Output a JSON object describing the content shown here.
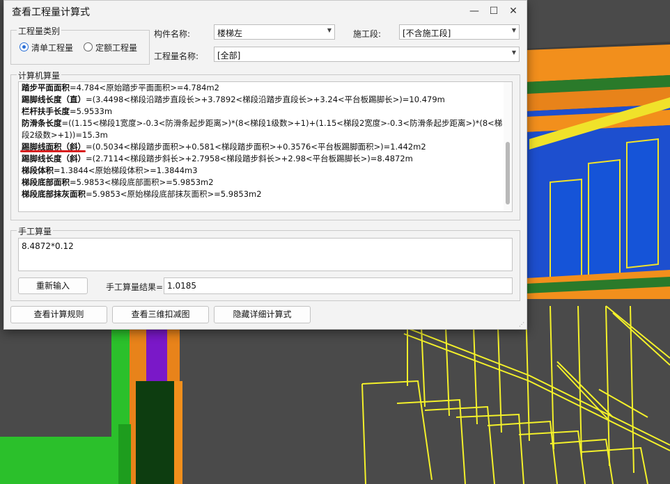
{
  "window": {
    "title": "查看工程量计算式",
    "minimize": "—",
    "maximize": "☐",
    "close": "✕"
  },
  "category": {
    "group_label": "工程量类别",
    "options": [
      {
        "label": "清单工程量",
        "selected": true
      },
      {
        "label": "定额工程量",
        "selected": false
      }
    ]
  },
  "filters": {
    "component_label": "构件名称:",
    "component_value": "楼梯左",
    "stage_label": "施工段:",
    "stage_value": "[不含施工段]",
    "quantity_label": "工程量名称:",
    "quantity_value": "[全部]"
  },
  "computed": {
    "group_label": "计算机算量",
    "lines": [
      {
        "name": "踏步平面面积",
        "formula": "=4.784<原始踏步平面面积>=4.784m2"
      },
      {
        "name": "踢脚线长度（直）",
        "formula": "=(3.4498<梯段沿踏步直段长>+3.7892<梯段沿踏步直段长>+3.24<平台板踢脚长>)=10.479m"
      },
      {
        "name": "栏杆扶手长度",
        "formula": "=5.9533m"
      },
      {
        "name": "防滑条长度",
        "formula": "=((1.15<梯段1宽度>-0.3<防滑条起步距离>)*(8<梯段1级数>+1)+(1.15<梯段2宽度>-0.3<防滑条起步距离>)*(8<梯"
      },
      {
        "name": "",
        "formula": "段2级数>+1))=15.3m"
      },
      {
        "name": "踢脚线面积（斜）",
        "formula": "=(0.5034<梯段踏步面积>+0.581<梯段踏步面积>+0.3576<平台板踢脚面积>)=1.442m2"
      },
      {
        "name": "踢脚线长度（斜）",
        "formula": "=(2.7114<梯段踏步斜长>+2.7958<梯段踏步斜长>+2.98<平台板踢脚长>)=8.4872m"
      },
      {
        "name": "梯段体积",
        "formula": "=1.3844<原始梯段体积>=1.3844m3"
      },
      {
        "name": "梯段底部面积",
        "formula": "=5.9853<梯段底部面积>=5.9853m2"
      },
      {
        "name": "梯段底部抹灰面积",
        "formula": "=5.9853<原始梯段底部抹灰面积>=5.9853m2"
      }
    ]
  },
  "manual": {
    "group_label": "手工算量",
    "expression": "8.4872*0.12",
    "reenter_button": "重新输入",
    "result_label": "手工算量结果=",
    "result_value": "1.0185"
  },
  "bottom_buttons": {
    "rules": "查看计算规则",
    "view3d": "查看三维扣减图",
    "hide_detail": "隐藏详细计算式"
  },
  "colors": {
    "accent": "#2a6fd6",
    "annotation": "#d81e1e"
  }
}
